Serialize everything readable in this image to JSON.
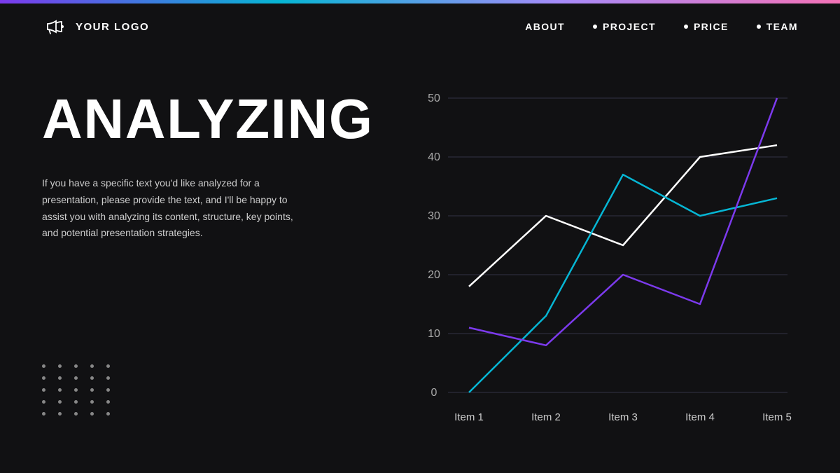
{
  "topBar": {},
  "header": {
    "logo": {
      "text": "YOUR LOGO"
    },
    "nav": {
      "items": [
        {
          "label": "ABOUT",
          "hasDot": false
        },
        {
          "label": "PROJECT",
          "hasDot": true
        },
        {
          "label": "PRICE",
          "hasDot": true
        },
        {
          "label": "TEAM",
          "hasDot": true
        }
      ]
    }
  },
  "leftContent": {
    "title": "ANALYZING",
    "description": "If you have a specific text you'd like analyzed for a presentation, please provide the text, and I'll be happy to assist you with analyzing its content, structure, key points, and potential presentation strategies."
  },
  "dotsGrid": {
    "rows": 5,
    "cols": 5
  },
  "chart": {
    "yAxis": {
      "labels": [
        "0",
        "10",
        "20",
        "30",
        "40",
        "50"
      ]
    },
    "xAxis": {
      "labels": [
        "Item 1",
        "Item 2",
        "Item 3",
        "Item 4",
        "Item 5"
      ]
    },
    "series": [
      {
        "name": "series-white",
        "color": "#ffffff",
        "points": [
          18,
          30,
          25,
          40,
          42
        ]
      },
      {
        "name": "series-cyan",
        "color": "#06b6d4",
        "points": [
          0,
          13,
          37,
          30,
          33
        ]
      },
      {
        "name": "series-purple",
        "color": "#7c3aed",
        "points": [
          11,
          8,
          20,
          15,
          50
        ]
      }
    ]
  }
}
